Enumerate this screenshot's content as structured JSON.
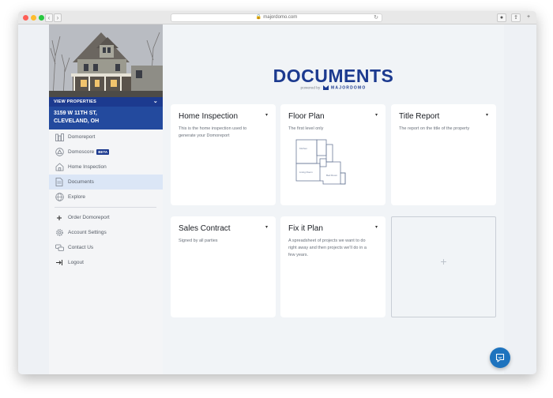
{
  "browser": {
    "url": "majordomo.com"
  },
  "sidebar": {
    "view_properties": "VIEW PROPERTIES",
    "address_line1": "3159 W 11TH ST,",
    "address_line2": "CLEVELAND, OH",
    "items": [
      {
        "label": "Domoreport",
        "icon": "report-icon"
      },
      {
        "label": "Domoscore",
        "icon": "score-icon",
        "badge": "BETA"
      },
      {
        "label": "Home Inspection",
        "icon": "house-icon"
      },
      {
        "label": "Documents",
        "icon": "document-icon",
        "active": true
      },
      {
        "label": "Explore",
        "icon": "globe-icon"
      }
    ],
    "secondary_items": [
      {
        "label": "Order Domoreport",
        "icon": "plus-icon"
      },
      {
        "label": "Account Settings",
        "icon": "gear-icon"
      },
      {
        "label": "Contact Us",
        "icon": "chat-bubbles-icon"
      },
      {
        "label": "Logout",
        "icon": "logout-icon"
      }
    ]
  },
  "main": {
    "title": "DOCUMENTS",
    "powered_by": "powered by",
    "brand": "MAJORDOMO",
    "cards": [
      {
        "title": "Home Inspection",
        "description": "This is the home inspection used to generate your Domoreport"
      },
      {
        "title": "Floor Plan",
        "description": "The first level only"
      },
      {
        "title": "Title Report",
        "description": "The report on the title of the property"
      },
      {
        "title": "Sales Contract",
        "description": "Signed by all parties"
      },
      {
        "title": "Fix it Plan",
        "description": "A spreadsheet of projects we want to do right away and then projects we'll do in a few years."
      }
    ],
    "add_card_symbol": "+",
    "floor_plan_rooms": [
      "Kitchen",
      "Living Room",
      "Bed Room"
    ]
  },
  "colors": {
    "brand_blue": "#1c3a8f",
    "active_row": "#dbe6f6",
    "chat_button": "#1e73be"
  }
}
